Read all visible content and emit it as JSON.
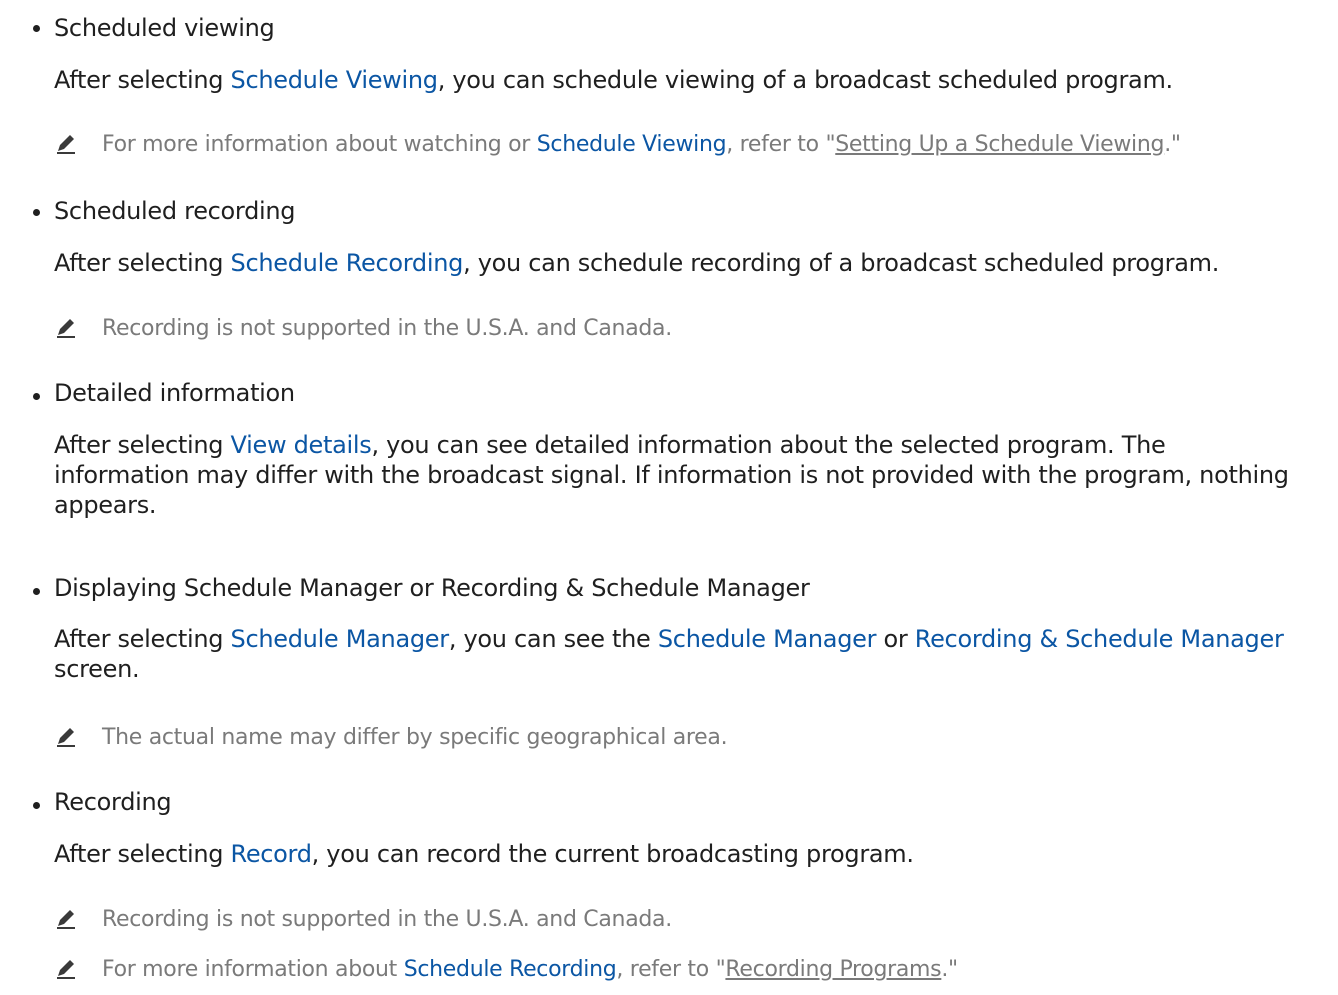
{
  "sections": [
    {
      "title": "Scheduled viewing",
      "body_before": "After selecting ",
      "body_link": "Schedule Viewing",
      "body_after": ", you can schedule viewing of a broadcast scheduled program.",
      "note": {
        "before": "For more information about watching or ",
        "link": "Schedule Viewing",
        "middle": ", refer to \"",
        "ref": "Setting Up a Schedule Viewing",
        "after": ".\""
      }
    },
    {
      "title": "Scheduled recording",
      "body_before": "After selecting ",
      "body_link": "Schedule Recording",
      "body_after": ", you can schedule recording of a broadcast scheduled program.",
      "note": "Recording is not supported in the U.S.A. and Canada."
    },
    {
      "title": "Detailed information",
      "body_before": "After selecting ",
      "body_link": "View details",
      "body_after": ", you can see detailed information about the selected program. The information may differ with the broadcast signal. If information is not provided with the program, nothing appears."
    },
    {
      "title": "Displaying Schedule Manager or Recording & Schedule Manager",
      "body_before": "After selecting ",
      "body_link": "Schedule Manager",
      "body_mid1": ", you can see the ",
      "body_link2": "Schedule Manager",
      "body_mid2": " or ",
      "body_link3": "Recording & Schedule Manager",
      "body_after": " screen.",
      "note": "The actual name may differ by specific geographical area."
    },
    {
      "title": "Recording",
      "body_before": "After selecting ",
      "body_link": "Record",
      "body_after": ", you can record the current broadcasting program.",
      "note1": "Recording is not supported in the U.S.A. and Canada.",
      "note2": {
        "before": "For more information about ",
        "link": "Schedule Recording",
        "middle": ", refer to \"",
        "ref": "Recording Programs",
        "after": ".\""
      }
    }
  ],
  "colors": {
    "link": "#0b56a4",
    "note": "#7a7a7a",
    "text": "#1f1f1f"
  },
  "note_icon": "pencil-icon"
}
